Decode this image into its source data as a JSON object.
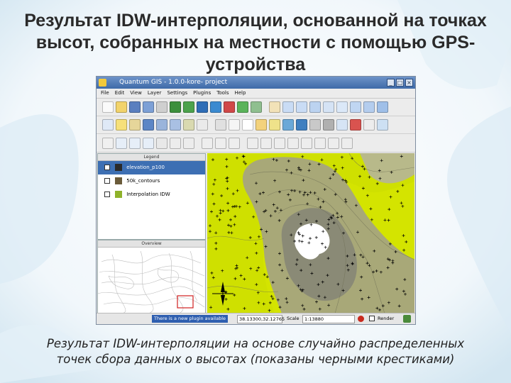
{
  "slide": {
    "title": "Результат IDW-интерполяции, основанной на точках высот, собранных на местности с помощью GPS-устройства",
    "caption": "Результат IDW-интерполяции на основе случайно распределенных точек сбора данных о высотах (показаны черными крестиками)"
  },
  "app": {
    "window_title": "Quantum GIS - 1.0.0-kore- project",
    "menu": [
      "File",
      "Edit",
      "View",
      "Layer",
      "Settings",
      "Plugins",
      "Tools",
      "Help"
    ],
    "legend_title": "Legend",
    "overview_title": "Overview",
    "layers": [
      {
        "name": "elevation_p100",
        "checked": true,
        "selected": true,
        "color": "#2a2a2a"
      },
      {
        "name": "50k_contours",
        "checked": true,
        "selected": false,
        "color": "#6b5b3a"
      },
      {
        "name": "Interpolation IDW",
        "checked": true,
        "selected": false,
        "color": "#8fb22a"
      }
    ],
    "status": {
      "message": "There is a new plugin available",
      "coordinates": "38.13300,32.12765",
      "scale_label": "Scale",
      "scale_value": "1:13880",
      "render_label": "Render"
    }
  },
  "colors": {
    "map_high": "#d4e400",
    "map_mid": "#a8a878",
    "map_peak": "#8a8a76",
    "map_top": "#ffffff",
    "accent": "#2f5fb0"
  }
}
